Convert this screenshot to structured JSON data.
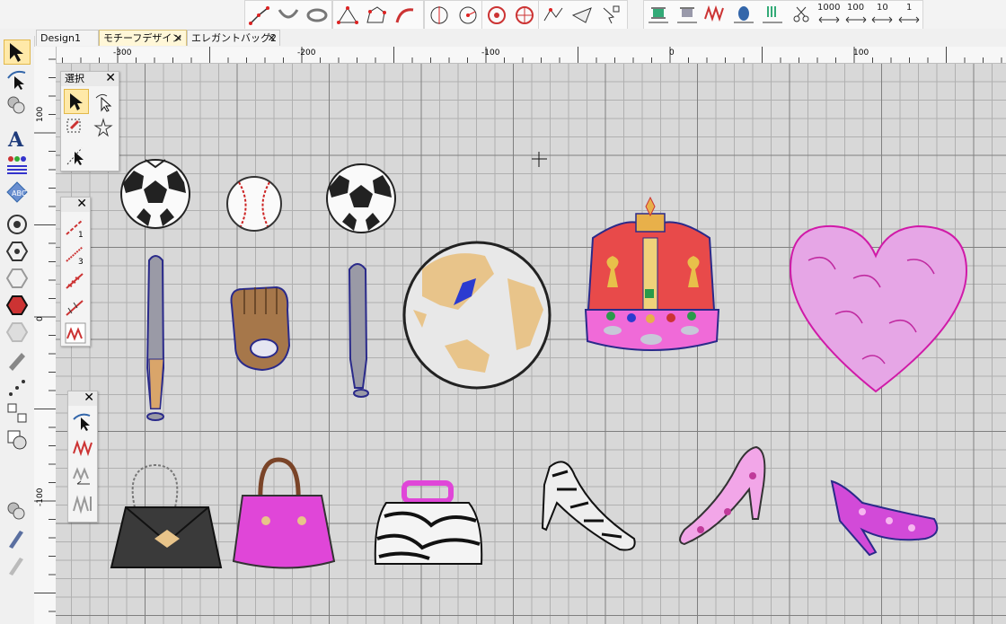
{
  "top_toolbar": {
    "icons": [
      "digitize-line-icon",
      "arc-icon",
      "ring-icon",
      "polygon-point-icon",
      "polygon-icon",
      "curve-icon",
      "center-circle-icon",
      "arc-circle-icon",
      "radial-icon",
      "wheel-icon",
      "polyline-icon",
      "plane-icon",
      "node-edit-icon",
      "thread-spool-icon",
      "thread-spool-2-icon",
      "zigzag-icon",
      "bobbin-icon",
      "fork-icon",
      "scissors-icon"
    ],
    "number_buttons": [
      "1000",
      "100",
      "10",
      "1"
    ]
  },
  "tabs": [
    {
      "label": "Design1",
      "active": false
    },
    {
      "label": "モチーフデザイン",
      "active": true
    },
    {
      "label": "エレガントバッグ2",
      "active": false
    }
  ],
  "close_glyph": "✕",
  "rulers": {
    "horizontal": [
      "-300",
      "-200",
      "-100",
      "0",
      "100"
    ],
    "vertical": [
      "100",
      "0",
      "-100"
    ]
  },
  "select_palette": {
    "title": "選択"
  },
  "colors": {
    "accent": "#ffe9a8",
    "grid_major": "#7f7f7f",
    "grid_minor": "#b0b0b0",
    "canvas": "#d8d8d8"
  }
}
